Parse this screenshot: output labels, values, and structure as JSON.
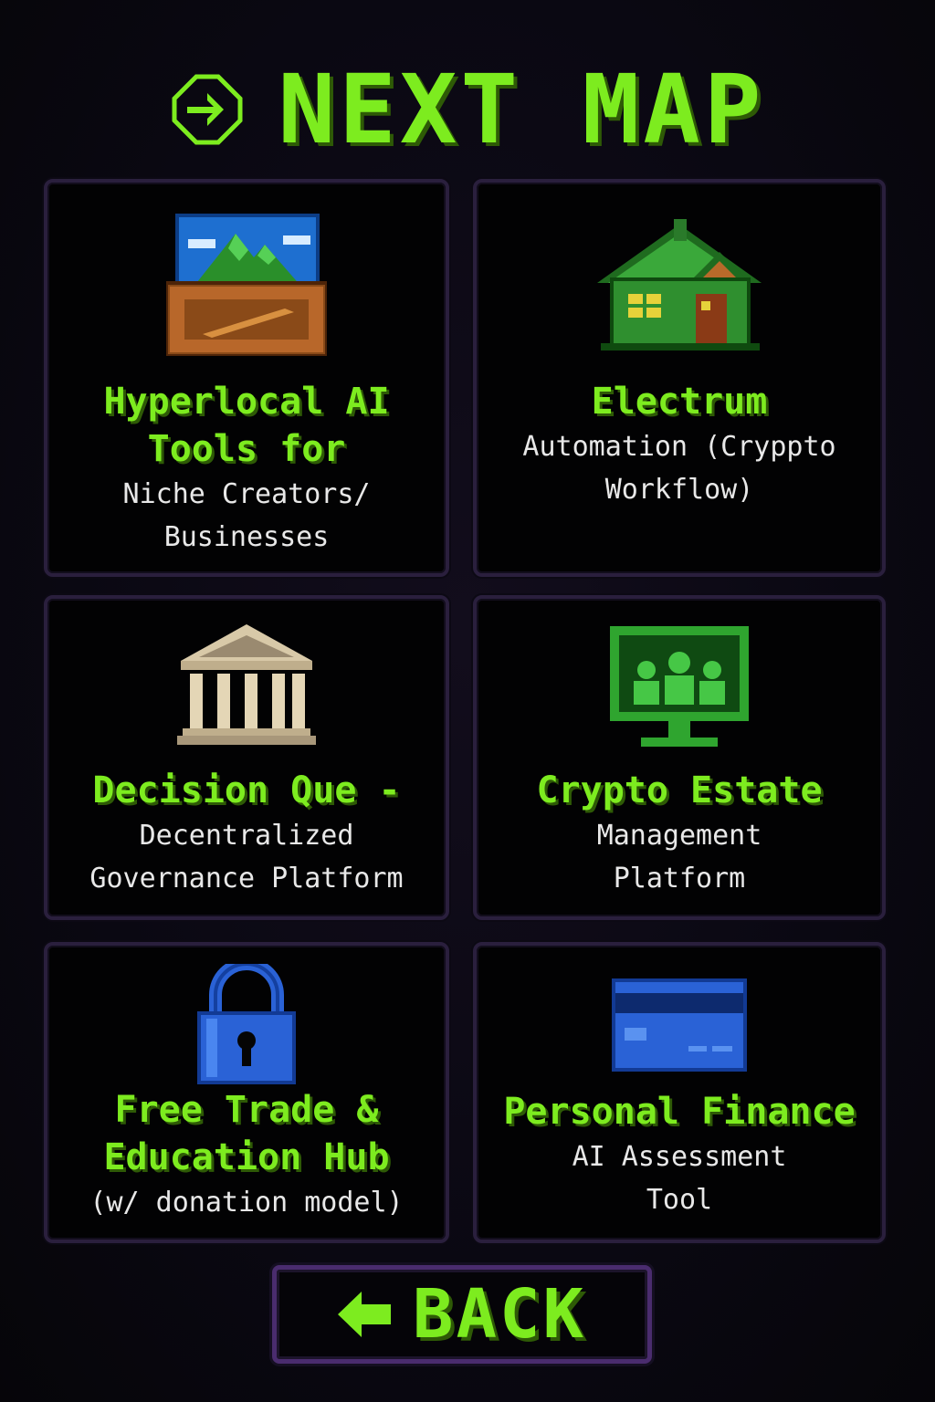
{
  "header": {
    "title": "NEXT MAP",
    "icon": "arrow-right-circle-icon"
  },
  "colors": {
    "accent_green": "#7dec1f",
    "card_border": "#2a1f3d",
    "button_border": "#4a2c6e",
    "background": "#0a0812"
  },
  "maps": [
    {
      "title": "Hyperlocal AI\nTools for",
      "subtitle": "Niche Creators/\nBusinesses",
      "icon": "landscape-painting-chest-icon"
    },
    {
      "title": "Electrum",
      "subtitle": "Automation (Cryppto\nWorkflow)",
      "icon": "green-house-icon"
    },
    {
      "title": "Decision Que -",
      "subtitle": "Decentralized\nGovernance Platform",
      "icon": "bank-building-icon"
    },
    {
      "title": "Crypto Estate",
      "subtitle": "Management\nPlatform",
      "icon": "monitor-people-icon"
    },
    {
      "title": "Free Trade &\nEducation Hub",
      "subtitle": "(w/ donation model)",
      "icon": "padlock-icon"
    },
    {
      "title": "Personal Finance",
      "subtitle": "AI Assessment\nTool",
      "icon": "credit-card-icon"
    }
  ],
  "back_button": {
    "label": "BACK",
    "icon": "arrow-left-icon"
  }
}
